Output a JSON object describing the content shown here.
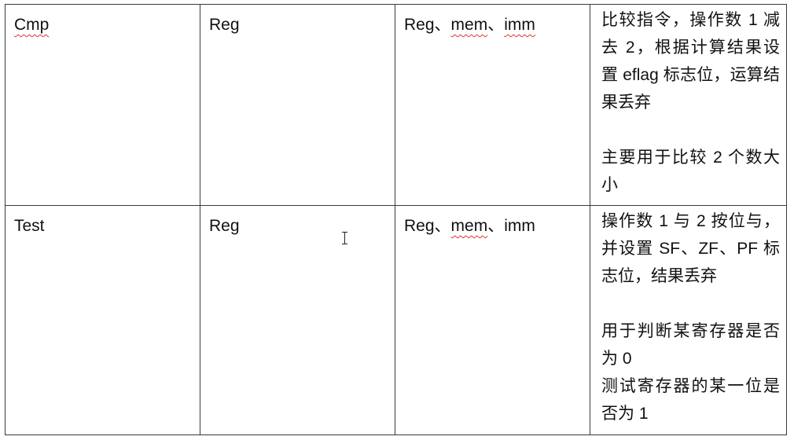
{
  "rows": [
    {
      "instr": "Cmp",
      "op1": "Reg",
      "op2": {
        "a": "Reg",
        "sep1": "、",
        "b": "mem",
        "sep2": "、",
        "c": "imm"
      },
      "desc": {
        "p1": "比较指令，操作数 1 减去 2，根据计算结果设置 eflag 标志位，运算结果丢弃",
        "p2": "主要用于比较 2 个数大小"
      }
    },
    {
      "instr": "Test",
      "op1": "Reg",
      "op2": {
        "a": "Reg",
        "sep1": "、",
        "b": "mem",
        "sep2": "、",
        "c": "imm"
      },
      "desc": {
        "p1": "操作数 1 与 2 按位与，并设置 SF、ZF、PF 标志位，结果丢弃",
        "p2": "用于判断某寄存器是否为 0",
        "p3": "测试寄存器的某一位是否为 1"
      }
    }
  ],
  "colors": {
    "border": "#3a3a3a",
    "spellcheck_underline": "#d33"
  }
}
